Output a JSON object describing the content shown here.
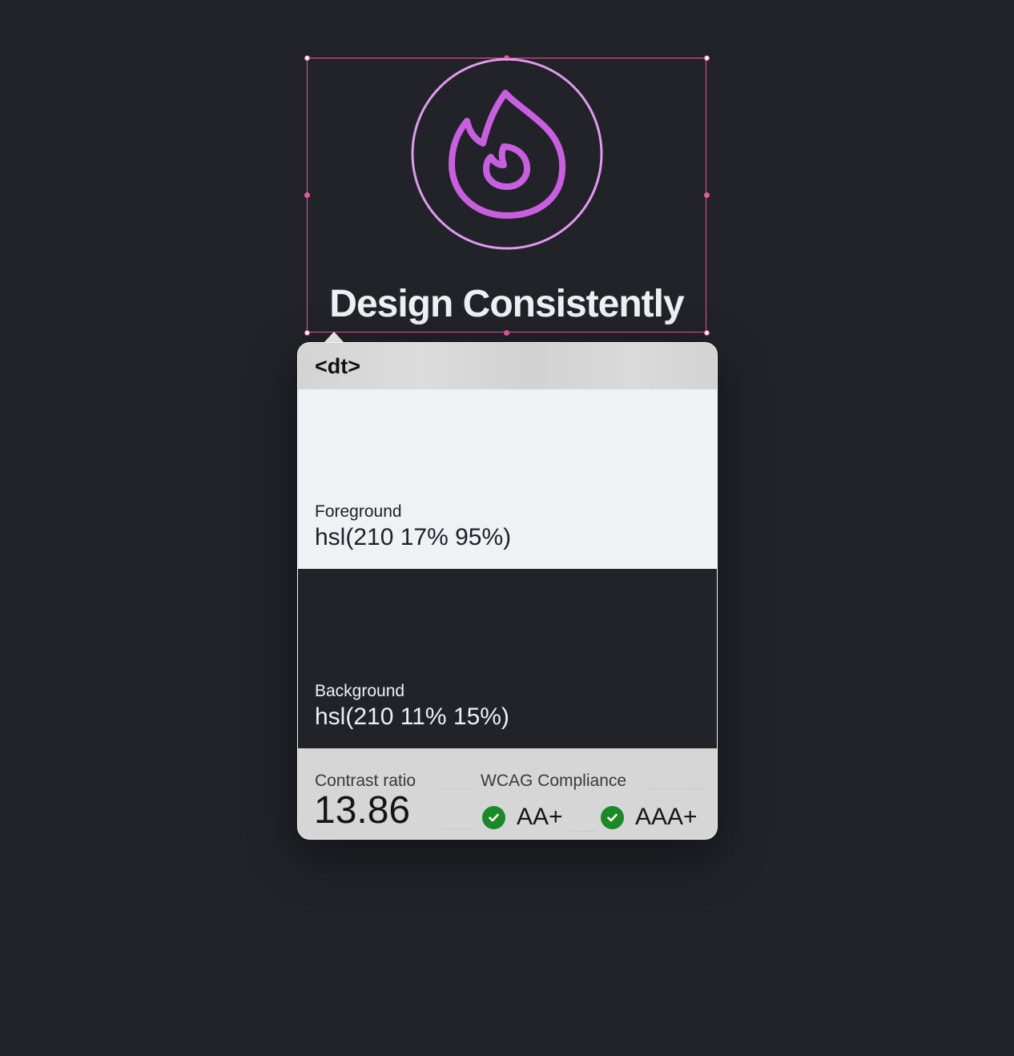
{
  "canvas": {
    "headline": "Design Consistently",
    "icon": "flame-icon",
    "accent_color": "#c95fe0",
    "selection_color": "#e05a9e"
  },
  "inspector": {
    "element_tag": "<dt>",
    "foreground": {
      "label": "Foreground",
      "value": "hsl(210 17% 95%)",
      "swatch_color": "#eff2f5"
    },
    "background": {
      "label": "Background",
      "value": "hsl(210 11% 15%)",
      "swatch_color": "#212329"
    },
    "contrast": {
      "label": "Contrast ratio",
      "value": "13.86"
    },
    "wcag": {
      "label": "WCAG Compliance",
      "badges": [
        {
          "label": "AA+",
          "status": "pass",
          "icon": "check-circle-icon",
          "color": "#1a8a26"
        },
        {
          "label": "AAA+",
          "status": "pass",
          "icon": "check-circle-icon",
          "color": "#1a8a26"
        }
      ]
    }
  }
}
